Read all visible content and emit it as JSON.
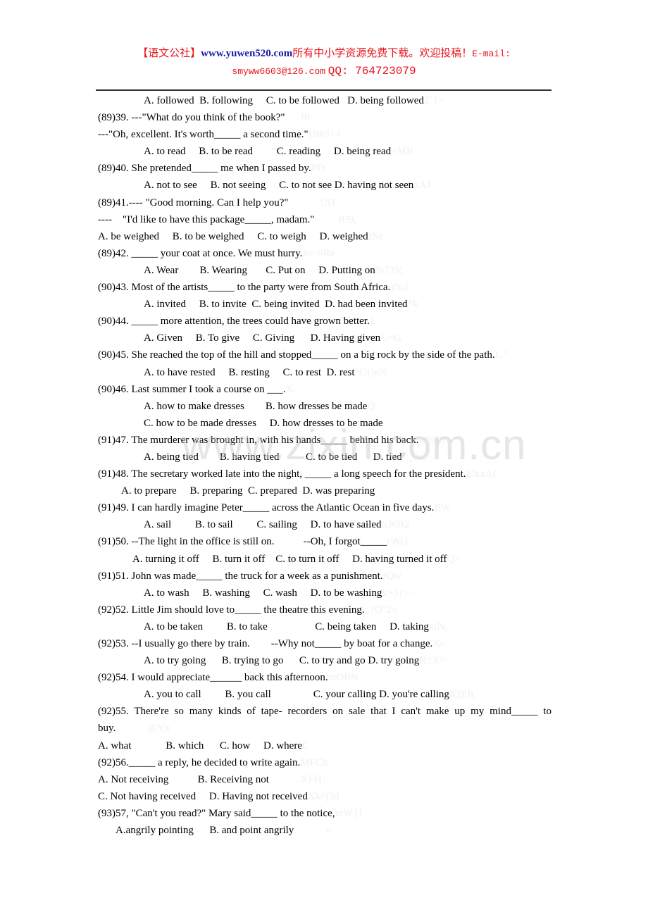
{
  "header": {
    "brand": "【语文公社】",
    "site": "www.yuwen520.com",
    "slogan": "所有中小学资源免费下载。欢迎投稿！",
    "email_label": "E-mail:",
    "email": "smyww6603@126.com",
    "qq": "QQ: 764723079"
  },
  "watermark": "www.zixin.com.cn",
  "lines": [
    {
      "text": "A. followed  B. following     C. to be followed   D. being followed",
      "indent": 1,
      "noise": "2`1="
    },
    {
      "text": "(89)39. ---\"What do you think of the book?\"",
      "indent": 0,
      "noise": "      !0"
    },
    {
      "text": "---\"Oh, excellent. It's worth_____ a second time.\"",
      "indent": 0,
      "noise": "Ut#d++"
    },
    {
      "text": "A. to read     B. to be read         C. reading     D. being read",
      "indent": 1,
      "noise": "+MB"
    },
    {
      "text": "(89)40. She pretended_____ me when I passed by.",
      "indent": 0,
      "noise": "PD"
    },
    {
      "text": "A. not to see     B. not seeing     C. to not see D. having not seen",
      "indent": 1,
      "noise": "xAJ"
    },
    {
      "text": "(89)41.---- \"Good morning. Can I help you?\"",
      "indent": 0,
      "noise": "            !AT"
    },
    {
      "text": "----    \"I'd like to have this package_____, madam.\"",
      "indent": 0,
      "noise": "         R!9,"
    },
    {
      "text": "A. be weighed     B. to be weighed     C. to weigh     D. weighed",
      "indent": 0,
      "noise": "INr"
    },
    {
      "text": "(89)42. _____ your coat at once. We must hurry.",
      "indent": 0,
      "noise": "Ju=0Re"
    },
    {
      "text": "A. Wear        B. Wearing       C. Put on     D. Putting on",
      "indent": 1,
      "noise": "%73V,"
    },
    {
      "text": "(90)43. Most of the artists_____ to the party were from South Africa.",
      "indent": 0,
      "noise": ")%2"
    },
    {
      "text": "A. invited     B. to invite  C. being invited  D. had been invited",
      "indent": 1,
      "noise": "*k"
    },
    {
      "text": "(90)44. _____ more attention, the trees could have grown better.",
      "indent": 0,
      "noise": "2"
    },
    {
      "text": "A. Given     B. To give     C. Giving      D. Having given",
      "indent": 1,
      "noise": "U=G"
    },
    {
      "text": "(90)45. She reached the top of the hill and stopped_____ on a big rock by the side of the path.",
      "indent": 0,
      "noise": "L.\""
    },
    {
      "text": "A. to have rested     B. resting     C. to rest  D. rest",
      "indent": 1,
      "noise": "^G()eN"
    },
    {
      "text": "(90)46. Last summer I took a course on ___.",
      "indent": 0,
      "noise": "X"
    },
    {
      "text": "A. how to make dresses        B. how dresses be made",
      "indent": 1,
      "noise": "Q"
    },
    {
      "text": "C. how to be made dresses     D. how dresses to be made",
      "indent": 1,
      "noise": ""
    },
    {
      "text": "(91)47. The murderer was brought in, with his hands_____ behind his back.",
      "indent": 0,
      "noise": "w%@"
    },
    {
      "text": "A. being tied        B. having tied          C. to be tied      D. tied",
      "indent": 1,
      "noise": "  _0u:"
    },
    {
      "text": "(91)48. The secretary worked late into the night, _____ a long speech for the president.",
      "indent": 0,
      "noise": "2!kaAI"
    },
    {
      "text": "A. to prepare     B. preparing  C. prepared  D. was preparing",
      "indent": 2,
      "noise": ""
    },
    {
      "text": "(91)49. I can hardly imagine Peter_____ across the Atlantic Ocean in five days.",
      "indent": 0,
      "noise": "BW"
    },
    {
      "text": "A. sail         B. to sail         C. sailing     D. to have sailed",
      "indent": 1,
      "noise": "o36B2"
    },
    {
      "text": "(91)50. --The light in the office is still on.           --Oh, I forgot_____",
      "indent": 0,
      "noise": "r|&({"
    },
    {
      "text": "A. turning it off     B. turn it off    C. to turn it off     D. having turned it off",
      "indent": 3,
      "noise": "Q>"
    },
    {
      "text": "(91)51. John was made_____ the truck for a week as a punishment.",
      "indent": 0,
      "noise": "rQw"
    },
    {
      "text": "A. to wash     B. washing     C. wash     D. to be washing",
      "indent": 1,
      "noise": "k+5{:~"
    },
    {
      "text": "(92)52. Little Jim should love to_____ the theatre this evening.",
      "indent": 0,
      "noise": "_?O\"2+"
    },
    {
      "text": "A. to be taken         B. to take                  C. being taken     D. taking",
      "indent": 1,
      "noise": "ktN,"
    },
    {
      "text": "(92)53. --I usually go there by train.        --Why not_____ by boat for a change.",
      "indent": 0,
      "noise": "Xc"
    },
    {
      "text": "A. to try going      B. trying to go      C. to try and go D. try going",
      "indent": 1,
      "noise": "R/;X^"
    },
    {
      "text": "(92)54. I would appreciate______ back this afternoon.",
      "indent": 0,
      "noise": "utOBN"
    },
    {
      "text": "A. you to call         B. you call                C. your calling D. you're calling",
      "indent": 1,
      "noise": "fQ)!R"
    },
    {
      "text": "(92)55. There're so many kinds of tape- recorders on sale that I can't make up my mind_____ to",
      "indent": 0,
      "justify": true,
      "noise": ""
    },
    {
      "text": "buy.",
      "indent": 0,
      "noise": "            @Yx"
    },
    {
      "text": "A. what             B. which      C. how     D. where",
      "indent": 0,
      "noise": "C"
    },
    {
      "text": "(92)56._____ a reply, he decided to write again.",
      "indent": 0,
      "noise": "MFCh"
    },
    {
      "text": "A. Not receiving           B. Receiving not",
      "indent": 0,
      "noise": "            XFH`"
    },
    {
      "text": "C. Not having received     D. Having not received",
      "indent": 0,
      "noise": "Xk^j3d"
    },
    {
      "text": "(93)57, \"Can't you read?\" Mary said_____ to the notice,",
      "indent": 0,
      "noise": "mW{J"
    },
    {
      "text": "A.angrily pointing      B. and point angrily",
      "indent": 4,
      "noise": "            v"
    }
  ]
}
